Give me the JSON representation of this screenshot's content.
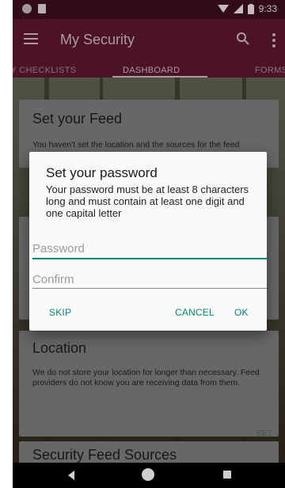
{
  "status_bar": {
    "time": "9:33"
  },
  "app_bar": {
    "title": "My Security"
  },
  "tabs": [
    {
      "label": "MY CHECKLISTS"
    },
    {
      "label": "DASHBOARD"
    },
    {
      "label": "FORMS"
    }
  ],
  "cards": {
    "feed": {
      "title": "Set your Feed",
      "body": "You haven't set the location and the sources for the feed"
    },
    "location": {
      "title": "Location",
      "body": "We do not store your location for longer than necessary. Feed providers do not know you are receiving data from them.",
      "action": "SET"
    },
    "sources": {
      "title": "Security Feed Sources"
    }
  },
  "dialog": {
    "title": "Set your password",
    "message": "Your password must be at least 8 characters long and must contain at least one digit and one capital letter",
    "password_placeholder": "Password",
    "confirm_placeholder": "Confirm",
    "skip": "SKIP",
    "cancel": "CANCEL",
    "ok": "OK"
  },
  "colors": {
    "accent": "#008b74",
    "app_bar": "#5a1730",
    "status_bar": "#3a0f1d"
  }
}
